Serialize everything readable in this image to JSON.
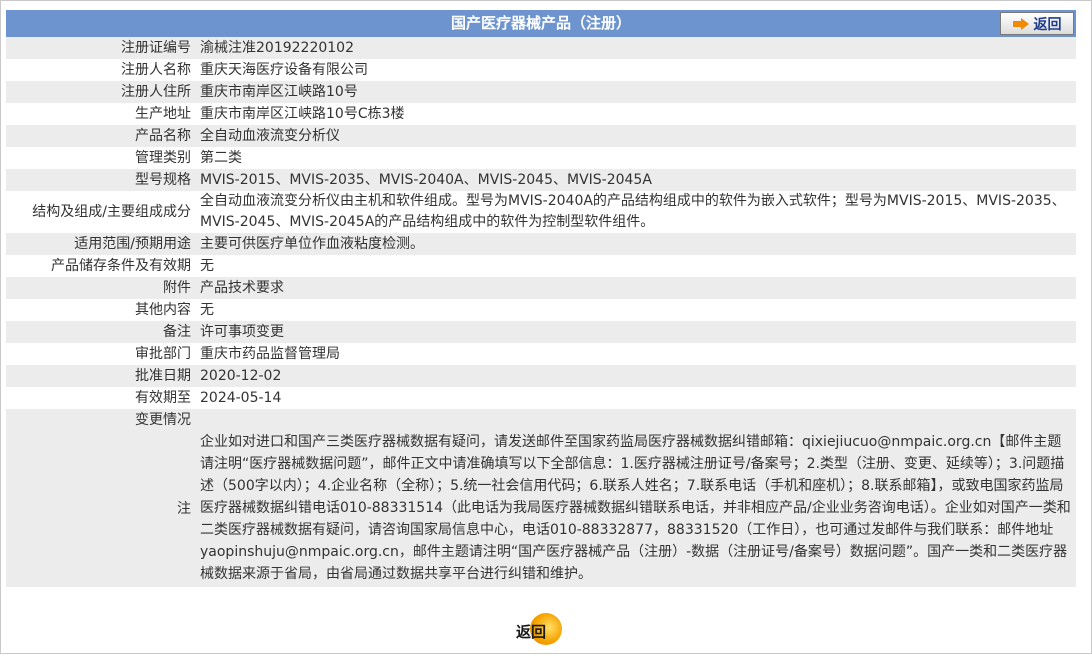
{
  "header": {
    "title": "国产医疗器械产品（注册）",
    "back_label": "返回"
  },
  "rows": [
    {
      "label": "注册证编号",
      "value": "渝械注准20192220102"
    },
    {
      "label": "注册人名称",
      "value": "重庆天海医疗设备有限公司"
    },
    {
      "label": "注册人住所",
      "value": "重庆市南岸区江峡路10号"
    },
    {
      "label": "生产地址",
      "value": "重庆市南岸区江峡路10号C栋3楼"
    },
    {
      "label": "产品名称",
      "value": "全自动血液流变分析仪"
    },
    {
      "label": "管理类别",
      "value": "第二类"
    },
    {
      "label": "型号规格",
      "value": "MVIS-2015、MVIS-2035、MVIS-2040A、MVIS-2045、MVIS-2045A"
    },
    {
      "label": "结构及组成/主要组成成分",
      "value": "全自动血液流变分析仪由主机和软件组成。型号为MVIS-2040A的产品结构组成中的软件为嵌入式软件；型号为MVIS-2015、MVIS-2035、MVIS-2045、MVIS-2045A的产品结构组成中的软件为控制型软件组件。"
    },
    {
      "label": "适用范围/预期用途",
      "value": "主要可供医疗单位作血液粘度检测。"
    },
    {
      "label": "产品储存条件及有效期",
      "value": "无"
    },
    {
      "label": "附件",
      "value": "产品技术要求"
    },
    {
      "label": "其他内容",
      "value": "无"
    },
    {
      "label": "备注",
      "value": "许可事项变更"
    },
    {
      "label": "审批部门",
      "value": "重庆市药品监督管理局"
    },
    {
      "label": "批准日期",
      "value": "2020-12-02"
    },
    {
      "label": "有效期至",
      "value": "2024-05-14"
    },
    {
      "label": "变更情况",
      "value": ""
    }
  ],
  "note": {
    "label": "注",
    "text": "企业如对进口和国产三类医疗器械数据有疑问，请发送邮件至国家药监局医疗器械数据纠错邮箱：qixiejiucuo@nmpaic.org.cn【邮件主题请注明“医疗器械数据问题”，邮件正文中请准确填写以下全部信息：1.医疗器械注册证号/备案号；2.类型（注册、变更、延续等）；3.问题描述（500字以内）；4.企业名称（全称）；5.统一社会信用代码；6.联系人姓名；7.联系电话（手机和座机）；8.联系邮箱】，或致电国家药监局医疗器械数据纠错电话010-88331514（此电话为我局医疗器械数据纠错联系电话，并非相应产品/企业业务咨询电话）。企业如对国产一类和二类医疗器械数据有疑问，请咨询国家局信息中心，电话010-88332877，88331520（工作日），也可通过发邮件与我们联系：邮件地址yaopinshuju@nmpaic.org.cn，邮件主题请注明“国产医疗器械产品（注册）-数据（注册证号/备案号）数据问题”。国产一类和二类医疗器械数据来源于省局，由省局通过数据共享平台进行纠错和维护。"
  },
  "footer": {
    "back_label": "返回"
  },
  "colors": {
    "header_bg": "#6d94cf",
    "row_gray": "#ececec",
    "accent_orange": "#f08a00"
  }
}
